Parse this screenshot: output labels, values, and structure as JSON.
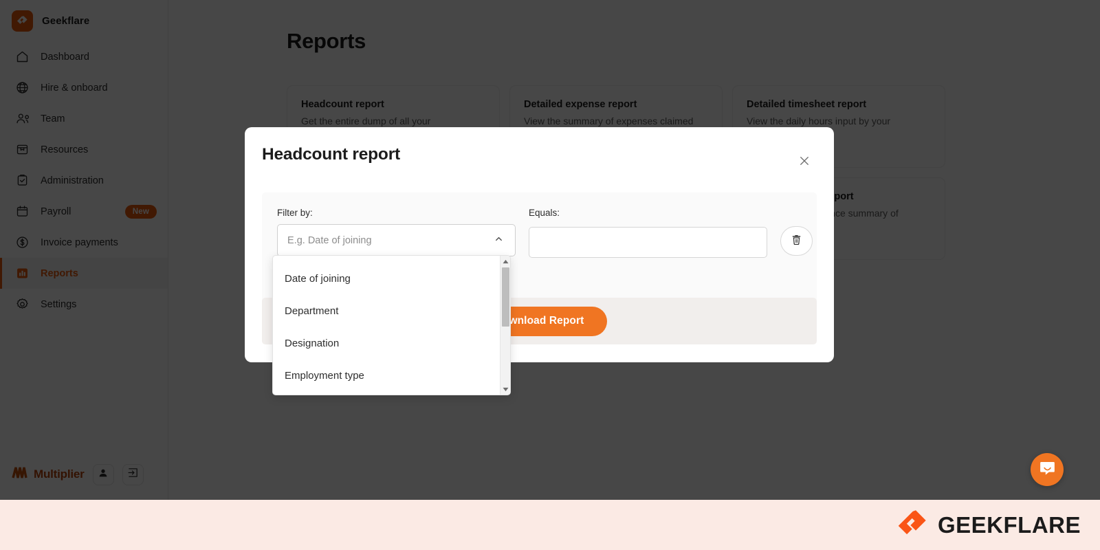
{
  "sidebar": {
    "brand": {
      "name": "Geekflare",
      "logo_icon": "geekflare-logo-icon"
    },
    "items": [
      {
        "label": "Dashboard",
        "icon": "home-icon",
        "active": false,
        "badge": null
      },
      {
        "label": "Hire & onboard",
        "icon": "globe-icon",
        "active": false,
        "badge": null
      },
      {
        "label": "Team",
        "icon": "people-icon",
        "active": false,
        "badge": null
      },
      {
        "label": "Resources",
        "icon": "archive-icon",
        "active": false,
        "badge": null
      },
      {
        "label": "Administration",
        "icon": "clipboard-check-icon",
        "active": false,
        "badge": null
      },
      {
        "label": "Payroll",
        "icon": "calendar-icon",
        "active": false,
        "badge": "New"
      },
      {
        "label": "Invoice payments",
        "icon": "dollar-circle-icon",
        "active": false,
        "badge": null
      },
      {
        "label": "Reports",
        "icon": "bar-chart-icon",
        "active": true,
        "badge": null
      },
      {
        "label": "Settings",
        "icon": "gear-icon",
        "active": false,
        "badge": null
      }
    ],
    "footer": {
      "product_name": "Multiplier",
      "logo_icon": "multiplier-logo-icon",
      "profile_icon": "person-icon",
      "logout_icon": "logout-icon"
    }
  },
  "main": {
    "title": "Reports",
    "cards": [
      {
        "title": "Headcount report",
        "desc": "Get the entire dump of all your"
      },
      {
        "title": "Detailed expense report",
        "desc": "View the summary of expenses claimed"
      },
      {
        "title": "Detailed timesheet report",
        "desc": "View the daily hours input by your"
      },
      {
        "title": "Leave summary report",
        "desc": "View the leave balance summary of"
      }
    ]
  },
  "modal": {
    "title": "Headcount report",
    "close_icon": "close-icon",
    "filter_label": "Filter by:",
    "equals_label": "Equals:",
    "filter_placeholder": "E.g. Date of joining",
    "filter_value": "",
    "equals_value": "",
    "equals_placeholder": "",
    "chevron_icon": "chevron-up-icon",
    "delete_icon": "trash-icon",
    "download_label": "Download Report"
  },
  "dropdown": {
    "open": true,
    "options": [
      "Date of joining",
      "Department",
      "Designation",
      "Employment type"
    ],
    "scroll_up_icon": "caret-up-icon",
    "scroll_down_icon": "caret-down-icon"
  },
  "chat": {
    "icon": "intercom-chat-icon"
  },
  "watermark": {
    "text": "GEEKFLARE",
    "icon": "geekflare-logo-icon"
  },
  "colors": {
    "accent_orange": "#e8590c",
    "button_orange": "#f07522",
    "watermark_bg": "#fbeae4",
    "overlay": "rgba(0,0,0,0.72)",
    "panel_gray": "#fafafa",
    "footer_gray": "#f1eeec"
  }
}
